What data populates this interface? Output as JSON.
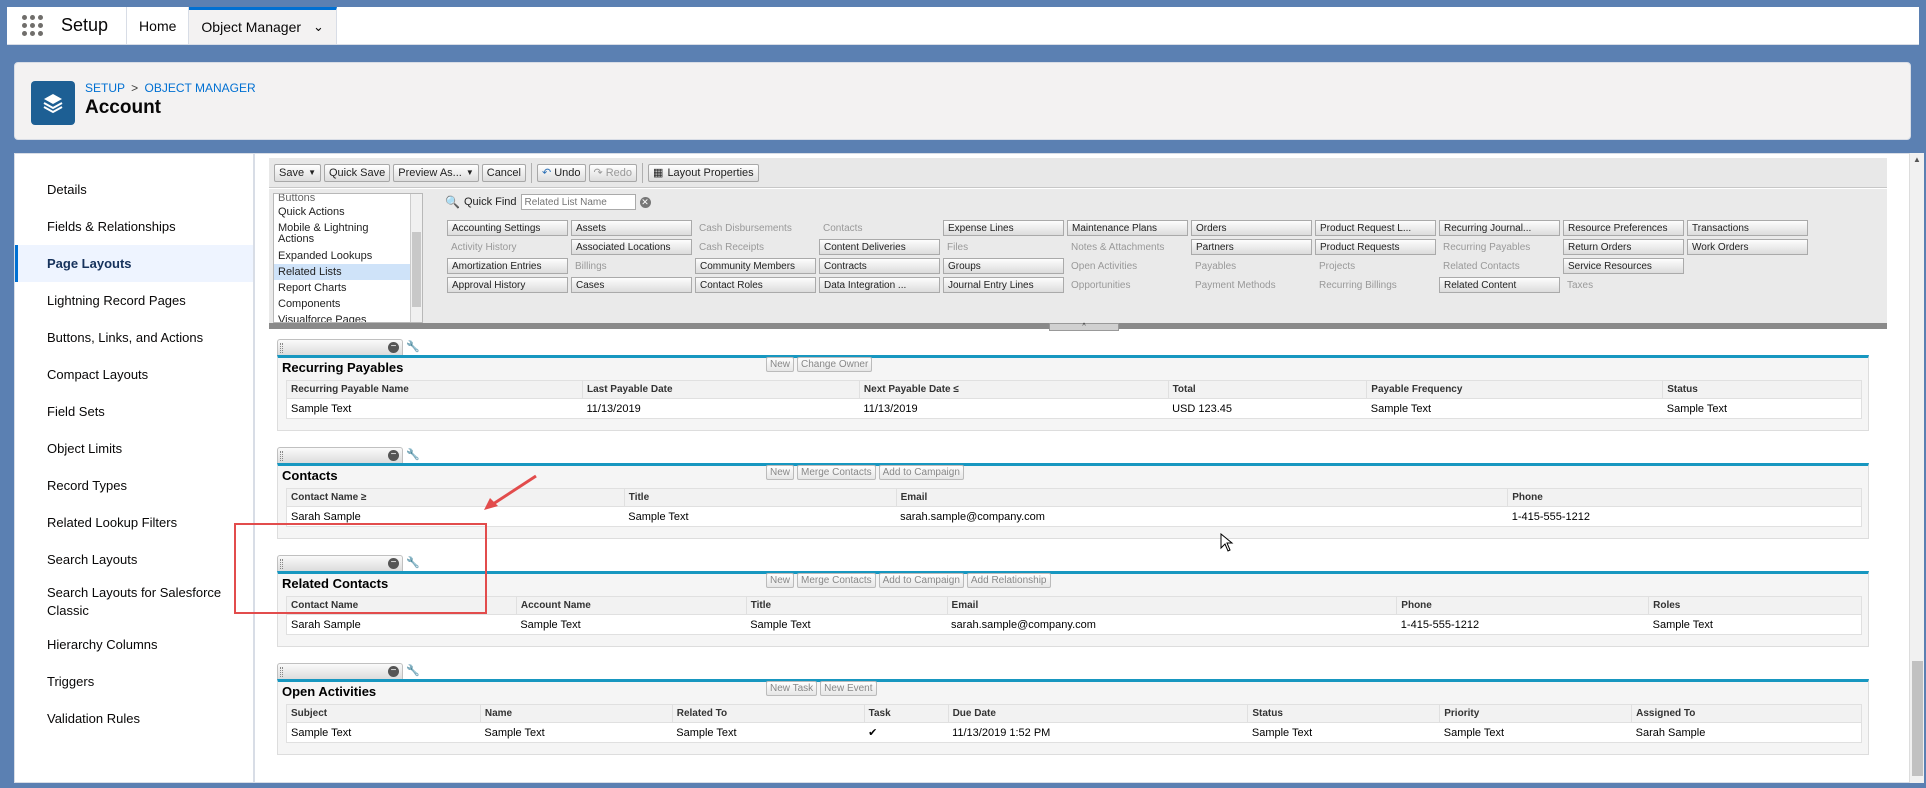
{
  "app": {
    "name": "Setup"
  },
  "nav_tabs": [
    {
      "label": "Home"
    },
    {
      "label": "Object Manager"
    }
  ],
  "header": {
    "crumb_setup": "SETUP",
    "crumb_sep": ">",
    "crumb_object_manager": "OBJECT MANAGER",
    "title": "Account",
    "icon": "layers-icon",
    "icon_color": "#1d5f94"
  },
  "sidebar": {
    "items": [
      {
        "label": "Details"
      },
      {
        "label": "Fields & Relationships"
      },
      {
        "label": "Page Layouts"
      },
      {
        "label": "Lightning Record Pages"
      },
      {
        "label": "Buttons, Links, and Actions"
      },
      {
        "label": "Compact Layouts"
      },
      {
        "label": "Field Sets"
      },
      {
        "label": "Object Limits"
      },
      {
        "label": "Record Types"
      },
      {
        "label": "Related Lookup Filters"
      },
      {
        "label": "Search Layouts"
      },
      {
        "label": "Search Layouts for Salesforce Classic"
      },
      {
        "label": "Hierarchy Columns"
      },
      {
        "label": "Triggers"
      },
      {
        "label": "Validation Rules"
      }
    ]
  },
  "toolbar": {
    "save": "Save",
    "quick_save": "Quick Save",
    "preview_as": "Preview As...",
    "cancel": "Cancel",
    "undo": "Undo",
    "redo": "Redo",
    "layout_properties": "Layout Properties"
  },
  "palette": {
    "categories": [
      {
        "label": "Buttons"
      },
      {
        "label": "Quick Actions"
      },
      {
        "label": "Mobile & Lightning Actions"
      },
      {
        "label": "Expanded Lookups"
      },
      {
        "label": "Related Lists"
      },
      {
        "label": "Report Charts"
      },
      {
        "label": "Components"
      },
      {
        "label": "Visualforce Pages"
      }
    ],
    "quick_find_label": "Quick Find",
    "quick_find_placeholder": "Related List Name",
    "items": [
      {
        "label": "Accounting Settings",
        "avail": true
      },
      {
        "label": "Assets",
        "avail": true
      },
      {
        "label": "Cash Disbursements",
        "avail": false
      },
      {
        "label": "Contacts",
        "avail": false
      },
      {
        "label": "Expense Lines",
        "avail": true
      },
      {
        "label": "Maintenance Plans",
        "avail": true
      },
      {
        "label": "Orders",
        "avail": true
      },
      {
        "label": "Product Request L...",
        "avail": true
      },
      {
        "label": "Recurring Journal...",
        "avail": true
      },
      {
        "label": "Resource Preferences",
        "avail": true
      },
      {
        "label": "Transactions",
        "avail": true
      },
      {
        "label": "Activity History",
        "avail": false
      },
      {
        "label": "Associated Locations",
        "avail": true
      },
      {
        "label": "Cash Receipts",
        "avail": false
      },
      {
        "label": "Content Deliveries",
        "avail": true
      },
      {
        "label": "Files",
        "avail": false
      },
      {
        "label": "Notes & Attachments",
        "avail": false
      },
      {
        "label": "Partners",
        "avail": true
      },
      {
        "label": "Product Requests",
        "avail": true
      },
      {
        "label": "Recurring Payables",
        "avail": false
      },
      {
        "label": "Return Orders",
        "avail": true
      },
      {
        "label": "Work Orders",
        "avail": true
      },
      {
        "label": "Amortization Entries",
        "avail": true
      },
      {
        "label": "Billings",
        "avail": false
      },
      {
        "label": "Community Members",
        "avail": true
      },
      {
        "label": "Contracts",
        "avail": true
      },
      {
        "label": "Groups",
        "avail": true
      },
      {
        "label": "Open Activities",
        "avail": false
      },
      {
        "label": "Payables",
        "avail": false
      },
      {
        "label": "Projects",
        "avail": false
      },
      {
        "label": "Related Contacts",
        "avail": false
      },
      {
        "label": "Service Resources",
        "avail": true
      },
      {
        "label": "",
        "avail": false
      },
      {
        "label": "Approval History",
        "avail": true
      },
      {
        "label": "Cases",
        "avail": true
      },
      {
        "label": "Contact Roles",
        "avail": true
      },
      {
        "label": "Data Integration ...",
        "avail": true
      },
      {
        "label": "Journal Entry Lines",
        "avail": true
      },
      {
        "label": "Opportunities",
        "avail": false
      },
      {
        "label": "Payment Methods",
        "avail": false
      },
      {
        "label": "Recurring Billings",
        "avail": false
      },
      {
        "label": "Related Content",
        "avail": true
      },
      {
        "label": "Taxes",
        "avail": false
      }
    ]
  },
  "sections": [
    {
      "title": "Recurring Payables",
      "buttons": [
        "New",
        "Change Owner"
      ],
      "columns": [
        "Recurring Payable Name",
        "Last Payable Date",
        "Next Payable Date ≤",
        "Total",
        "Payable Frequency",
        "Status"
      ],
      "row": [
        "Sample Text",
        "11/13/2019",
        "11/13/2019",
        "USD 123.45",
        "Sample Text",
        "Sample Text"
      ]
    },
    {
      "title": "Contacts",
      "buttons": [
        "New",
        "Merge Contacts",
        "Add to Campaign"
      ],
      "columns": [
        "Contact Name ≥",
        "Title",
        "Email",
        "Phone"
      ],
      "row": [
        "Sarah Sample",
        "Sample Text",
        "sarah.sample@company.com",
        "1-415-555-1212"
      ]
    },
    {
      "title": "Related Contacts",
      "buttons": [
        "New",
        "Merge Contacts",
        "Add to Campaign",
        "Add Relationship"
      ],
      "columns": [
        "Contact Name",
        "Account Name",
        "Title",
        "Email",
        "Phone",
        "Roles"
      ],
      "row": [
        "Sarah Sample",
        "Sample Text",
        "Sample Text",
        "sarah.sample@company.com",
        "1-415-555-1212",
        "Sample Text"
      ]
    },
    {
      "title": "Open Activities",
      "buttons": [
        "New Task",
        "New Event"
      ],
      "columns": [
        "Subject",
        "Name",
        "Related To",
        "Task",
        "Due Date",
        "Status",
        "Priority",
        "Assigned To"
      ],
      "row": [
        "Sample Text",
        "Sample Text",
        "Sample Text",
        "✔",
        "11/13/2019 1:52 PM",
        "Sample Text",
        "Sample Text",
        "Sarah Sample"
      ]
    }
  ],
  "colors": {
    "accent": "#0070d2",
    "annotation": "#e24c4c",
    "section_rule": "#1797c0"
  }
}
